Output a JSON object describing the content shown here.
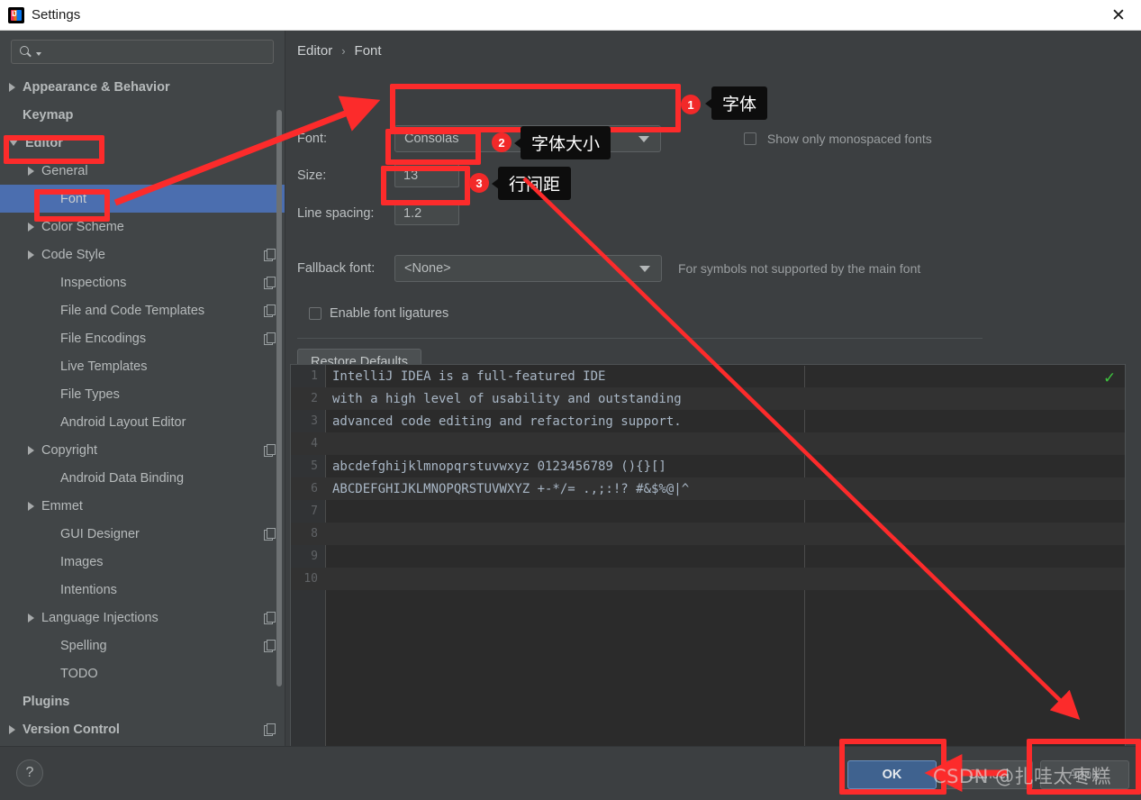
{
  "window": {
    "title": "Settings",
    "close_label": "✕",
    "app_icon": "intellij-idea-icon"
  },
  "sidebar": {
    "search": {
      "placeholder": "",
      "value": "",
      "icon": "search-icon"
    },
    "items": [
      {
        "label": "Appearance & Behavior",
        "indent": 0,
        "arrow": "right",
        "bold": true,
        "badge": false
      },
      {
        "label": "Keymap",
        "indent": 0,
        "arrow": "none",
        "bold": true,
        "badge": false
      },
      {
        "label": "Editor",
        "indent": 0,
        "arrow": "down",
        "bold": true,
        "badge": false
      },
      {
        "label": "General",
        "indent": 1,
        "arrow": "right",
        "bold": false,
        "badge": false
      },
      {
        "label": "Font",
        "indent": 2,
        "arrow": "none",
        "bold": false,
        "badge": false,
        "selected": true
      },
      {
        "label": "Color Scheme",
        "indent": 1,
        "arrow": "right",
        "bold": false,
        "badge": false
      },
      {
        "label": "Code Style",
        "indent": 1,
        "arrow": "right",
        "bold": false,
        "badge": true
      },
      {
        "label": "Inspections",
        "indent": 2,
        "arrow": "none",
        "bold": false,
        "badge": true
      },
      {
        "label": "File and Code Templates",
        "indent": 2,
        "arrow": "none",
        "bold": false,
        "badge": true
      },
      {
        "label": "File Encodings",
        "indent": 2,
        "arrow": "none",
        "bold": false,
        "badge": true
      },
      {
        "label": "Live Templates",
        "indent": 2,
        "arrow": "none",
        "bold": false,
        "badge": false
      },
      {
        "label": "File Types",
        "indent": 2,
        "arrow": "none",
        "bold": false,
        "badge": false
      },
      {
        "label": "Android Layout Editor",
        "indent": 2,
        "arrow": "none",
        "bold": false,
        "badge": false
      },
      {
        "label": "Copyright",
        "indent": 1,
        "arrow": "right",
        "bold": false,
        "badge": true
      },
      {
        "label": "Android Data Binding",
        "indent": 2,
        "arrow": "none",
        "bold": false,
        "badge": false
      },
      {
        "label": "Emmet",
        "indent": 1,
        "arrow": "right",
        "bold": false,
        "badge": false
      },
      {
        "label": "GUI Designer",
        "indent": 2,
        "arrow": "none",
        "bold": false,
        "badge": true
      },
      {
        "label": "Images",
        "indent": 2,
        "arrow": "none",
        "bold": false,
        "badge": false
      },
      {
        "label": "Intentions",
        "indent": 2,
        "arrow": "none",
        "bold": false,
        "badge": false
      },
      {
        "label": "Language Injections",
        "indent": 1,
        "arrow": "right",
        "bold": false,
        "badge": true
      },
      {
        "label": "Spelling",
        "indent": 2,
        "arrow": "none",
        "bold": false,
        "badge": true
      },
      {
        "label": "TODO",
        "indent": 2,
        "arrow": "none",
        "bold": false,
        "badge": false
      },
      {
        "label": "Plugins",
        "indent": 0,
        "arrow": "none",
        "bold": true,
        "badge": false
      },
      {
        "label": "Version Control",
        "indent": 0,
        "arrow": "right",
        "bold": true,
        "badge": true
      }
    ]
  },
  "main": {
    "breadcrumb": {
      "parent": "Editor",
      "separator": "›",
      "current": "Font"
    },
    "font_row": {
      "label": "Font:",
      "value": "Consolas"
    },
    "size_row": {
      "label": "Size:",
      "value": "13"
    },
    "spacing_row": {
      "label": "Line spacing:",
      "value": "1.2"
    },
    "monospace_checkbox": {
      "label": "Show only monospaced fonts",
      "checked": false
    },
    "fallback_row": {
      "label": "Fallback font:",
      "value": "<None>",
      "hint": "For symbols not supported by the main font"
    },
    "ligatures_checkbox": {
      "label": "Enable font ligatures",
      "checked": false
    },
    "restore_button": "Restore Defaults"
  },
  "preview": {
    "status_icon": "green-check-icon",
    "lines": [
      {
        "num": "1",
        "text": "IntelliJ IDEA is a full-featured IDE"
      },
      {
        "num": "2",
        "text": "with a high level of usability and outstanding"
      },
      {
        "num": "3",
        "text": "advanced code editing and refactoring support."
      },
      {
        "num": "4",
        "text": ""
      },
      {
        "num": "5",
        "text": "abcdefghijklmnopqrstuvwxyz 0123456789 (){}[]"
      },
      {
        "num": "6",
        "text": "ABCDEFGHIJKLMNOPQRSTUVWXYZ +-*/= .,;:!? #&$%@|^"
      },
      {
        "num": "7",
        "text": ""
      },
      {
        "num": "8",
        "text": ""
      },
      {
        "num": "9",
        "text": ""
      },
      {
        "num": "10",
        "text": ""
      }
    ]
  },
  "bottom": {
    "help_label": "?",
    "ok_label": "OK",
    "cancel_label": "Cancel",
    "apply_label": "Apply"
  },
  "annotations": {
    "badge1": "1",
    "badge2": "2",
    "badge3": "3",
    "tip1": "字体",
    "tip2": "字体大小",
    "tip3": "行间距",
    "highlight_color": "#fc2b2b"
  },
  "watermark": {
    "text": "CSDN @扎哇太枣糕"
  }
}
